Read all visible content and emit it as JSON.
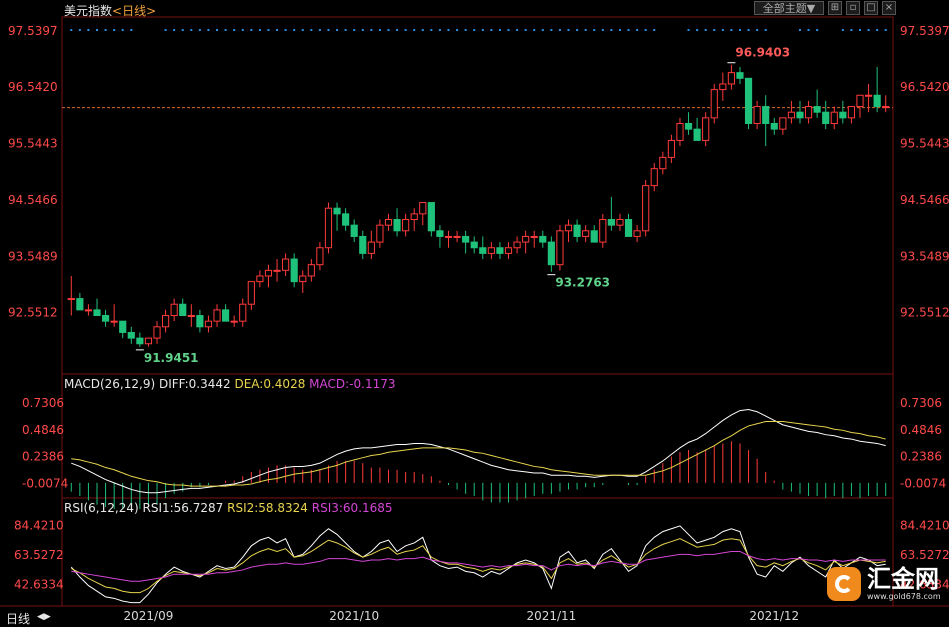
{
  "header": {
    "instrument": "美元指数",
    "timeframe": "<日线>",
    "theme_label": "全部主题▼",
    "icons": [
      "grid-icon",
      "restore-icon",
      "maximize-icon",
      "close-icon"
    ]
  },
  "chart_data": [
    {
      "type": "candlestick",
      "title": "美元指数 <日线>",
      "ylim": [
        91.5,
        97.75
      ],
      "y_ticks": [
        "97.5397",
        "96.5420",
        "95.5443",
        "94.5466",
        "93.5489",
        "92.5512"
      ],
      "x_ticks": [
        "2021/09",
        "2021/10",
        "2021/11",
        "2021/12"
      ],
      "annotations": {
        "high": "96.9403",
        "low1": "91.9451",
        "low2": "93.2763"
      },
      "last_price": 96.18,
      "candles": [
        [
          92.8,
          93.2,
          92.5,
          92.8
        ],
        [
          92.8,
          92.9,
          92.6,
          92.6
        ],
        [
          92.6,
          92.7,
          92.5,
          92.6
        ],
        [
          92.6,
          92.8,
          92.5,
          92.5
        ],
        [
          92.5,
          92.6,
          92.3,
          92.4
        ],
        [
          92.4,
          92.7,
          92.3,
          92.4
        ],
        [
          92.4,
          92.4,
          92.1,
          92.2
        ],
        [
          92.2,
          92.3,
          92.0,
          92.1
        ],
        [
          92.1,
          92.2,
          91.9451,
          92.0
        ],
        [
          92.0,
          92.1,
          91.95,
          92.1
        ],
        [
          92.1,
          92.4,
          92.0,
          92.3
        ],
        [
          92.3,
          92.6,
          92.2,
          92.5
        ],
        [
          92.5,
          92.8,
          92.4,
          92.7
        ],
        [
          92.7,
          92.8,
          92.5,
          92.5
        ],
        [
          92.5,
          92.7,
          92.3,
          92.5
        ],
        [
          92.5,
          92.6,
          92.2,
          92.3
        ],
        [
          92.3,
          92.5,
          92.2,
          92.4
        ],
        [
          92.4,
          92.7,
          92.3,
          92.6
        ],
        [
          92.6,
          92.7,
          92.4,
          92.4
        ],
        [
          92.4,
          92.5,
          92.3,
          92.4
        ],
        [
          92.4,
          92.8,
          92.3,
          92.7
        ],
        [
          92.7,
          93.1,
          92.6,
          93.1
        ],
        [
          93.1,
          93.3,
          93.0,
          93.2
        ],
        [
          93.2,
          93.4,
          93.0,
          93.3
        ],
        [
          93.3,
          93.5,
          93.1,
          93.3
        ],
        [
          93.3,
          93.6,
          93.2,
          93.5
        ],
        [
          93.5,
          93.6,
          93.0,
          93.1
        ],
        [
          93.1,
          93.3,
          92.9,
          93.2
        ],
        [
          93.2,
          93.5,
          93.1,
          93.4
        ],
        [
          93.4,
          93.8,
          93.3,
          93.7
        ],
        [
          93.7,
          94.5,
          93.6,
          94.4
        ],
        [
          94.4,
          94.5,
          94.0,
          94.3
        ],
        [
          94.3,
          94.4,
          94.0,
          94.1
        ],
        [
          94.1,
          94.2,
          93.8,
          93.9
        ],
        [
          93.9,
          94.0,
          93.5,
          93.6
        ],
        [
          93.6,
          94.0,
          93.5,
          93.8
        ],
        [
          93.8,
          94.2,
          93.7,
          94.1
        ],
        [
          94.1,
          94.3,
          94.0,
          94.2
        ],
        [
          94.2,
          94.4,
          93.9,
          94.0
        ],
        [
          94.0,
          94.3,
          93.9,
          94.2
        ],
        [
          94.2,
          94.4,
          94.0,
          94.3
        ],
        [
          94.3,
          94.5,
          94.1,
          94.5
        ],
        [
          94.5,
          94.5,
          93.9,
          94.0
        ],
        [
          94.0,
          94.1,
          93.7,
          93.9
        ],
        [
          93.9,
          94.0,
          93.7,
          93.9
        ],
        [
          93.9,
          94.0,
          93.8,
          93.9
        ],
        [
          93.9,
          94.0,
          93.6,
          93.8
        ],
        [
          93.8,
          93.9,
          93.6,
          93.7
        ],
        [
          93.7,
          93.9,
          93.5,
          93.6
        ],
        [
          93.6,
          93.8,
          93.5,
          93.7
        ],
        [
          93.7,
          93.8,
          93.5,
          93.6
        ],
        [
          93.6,
          93.8,
          93.5,
          93.7
        ],
        [
          93.7,
          93.9,
          93.6,
          93.8
        ],
        [
          93.8,
          94.0,
          93.6,
          93.9
        ],
        [
          93.9,
          94.0,
          93.7,
          93.9
        ],
        [
          93.9,
          94.0,
          93.7,
          93.8
        ],
        [
          93.8,
          93.9,
          93.2763,
          93.4
        ],
        [
          93.4,
          94.1,
          93.3,
          94.0
        ],
        [
          94.0,
          94.2,
          93.8,
          94.1
        ],
        [
          94.1,
          94.2,
          93.8,
          93.9
        ],
        [
          93.9,
          94.1,
          93.8,
          94.0
        ],
        [
          94.0,
          94.1,
          93.8,
          93.8
        ],
        [
          93.8,
          94.3,
          93.7,
          94.2
        ],
        [
          94.2,
          94.6,
          94.0,
          94.1
        ],
        [
          94.1,
          94.3,
          94.0,
          94.2
        ],
        [
          94.2,
          94.3,
          93.9,
          93.9
        ],
        [
          93.9,
          94.1,
          93.8,
          94.0
        ],
        [
          94.0,
          94.9,
          93.9,
          94.8
        ],
        [
          94.8,
          95.2,
          94.7,
          95.1
        ],
        [
          95.1,
          95.4,
          95.0,
          95.3
        ],
        [
          95.3,
          95.7,
          95.2,
          95.6
        ],
        [
          95.6,
          96.0,
          95.5,
          95.9
        ],
        [
          95.9,
          96.1,
          95.7,
          95.8
        ],
        [
          95.8,
          96.0,
          95.6,
          95.6
        ],
        [
          95.6,
          96.1,
          95.5,
          96.0
        ],
        [
          96.0,
          96.6,
          95.9,
          96.5
        ],
        [
          96.5,
          96.8,
          96.3,
          96.6
        ],
        [
          96.6,
          96.9403,
          96.5,
          96.8
        ],
        [
          96.8,
          96.9,
          96.6,
          96.7
        ],
        [
          96.7,
          96.7,
          95.8,
          95.9
        ],
        [
          95.9,
          96.3,
          95.8,
          96.2
        ],
        [
          96.2,
          96.4,
          95.5,
          95.9
        ],
        [
          95.9,
          96.0,
          95.7,
          95.8
        ],
        [
          95.8,
          96.0,
          95.7,
          96.0
        ],
        [
          96.0,
          96.3,
          95.9,
          96.1
        ],
        [
          96.1,
          96.3,
          95.9,
          96.0
        ],
        [
          96.0,
          96.3,
          95.9,
          96.2
        ],
        [
          96.2,
          96.5,
          96.0,
          96.1
        ],
        [
          96.1,
          96.3,
          95.8,
          95.9
        ],
        [
          95.9,
          96.2,
          95.8,
          96.1
        ],
        [
          96.1,
          96.3,
          95.9,
          96.0
        ],
        [
          96.0,
          96.2,
          95.9,
          96.2
        ],
        [
          96.2,
          96.4,
          96.0,
          96.4
        ],
        [
          96.4,
          96.6,
          96.1,
          96.4
        ],
        [
          96.4,
          96.9,
          96.1,
          96.2
        ],
        [
          96.2,
          96.4,
          96.1,
          96.2
        ]
      ]
    },
    {
      "type": "bar+line",
      "title": "MACD(26,12,9)",
      "legend": {
        "name": "MACD(26,12,9)",
        "diff": "DIFF:0.3442",
        "dea": "DEA:0.4028",
        "macd": "MACD:-0.1173"
      },
      "ylim": [
        -0.12,
        0.83
      ],
      "y_ticks": [
        "0.7306",
        "0.4846",
        "0.2386",
        "-0.0074"
      ],
      "series": [
        {
          "name": "DIFF",
          "color": "#ffffff",
          "values": [
            0.18,
            0.15,
            0.11,
            0.07,
            0.03,
            0.0,
            -0.03,
            -0.06,
            -0.08,
            -0.09,
            -0.09,
            -0.08,
            -0.07,
            -0.06,
            -0.05,
            -0.05,
            -0.04,
            -0.03,
            -0.02,
            -0.01,
            0.01,
            0.04,
            0.07,
            0.1,
            0.12,
            0.14,
            0.15,
            0.15,
            0.16,
            0.18,
            0.22,
            0.26,
            0.29,
            0.31,
            0.32,
            0.32,
            0.33,
            0.34,
            0.35,
            0.35,
            0.36,
            0.36,
            0.35,
            0.33,
            0.31,
            0.28,
            0.25,
            0.22,
            0.19,
            0.16,
            0.14,
            0.12,
            0.11,
            0.1,
            0.09,
            0.09,
            0.07,
            0.07,
            0.07,
            0.06,
            0.06,
            0.05,
            0.06,
            0.07,
            0.07,
            0.06,
            0.06,
            0.1,
            0.15,
            0.2,
            0.26,
            0.32,
            0.37,
            0.4,
            0.45,
            0.51,
            0.57,
            0.62,
            0.66,
            0.67,
            0.65,
            0.61,
            0.57,
            0.53,
            0.51,
            0.49,
            0.47,
            0.46,
            0.44,
            0.43,
            0.41,
            0.4,
            0.38,
            0.37,
            0.36,
            0.34
          ]
        },
        {
          "name": "DEA",
          "color": "#e8d44d",
          "values": [
            0.22,
            0.21,
            0.19,
            0.17,
            0.14,
            0.12,
            0.09,
            0.06,
            0.04,
            0.02,
            0.01,
            -0.01,
            -0.02,
            -0.02,
            -0.03,
            -0.03,
            -0.03,
            -0.03,
            -0.03,
            -0.02,
            -0.02,
            -0.01,
            0.01,
            0.03,
            0.04,
            0.06,
            0.08,
            0.09,
            0.1,
            0.12,
            0.14,
            0.16,
            0.19,
            0.21,
            0.23,
            0.25,
            0.26,
            0.28,
            0.29,
            0.3,
            0.31,
            0.32,
            0.32,
            0.32,
            0.32,
            0.31,
            0.3,
            0.28,
            0.27,
            0.25,
            0.23,
            0.21,
            0.19,
            0.17,
            0.15,
            0.14,
            0.12,
            0.11,
            0.1,
            0.09,
            0.08,
            0.07,
            0.07,
            0.07,
            0.07,
            0.07,
            0.07,
            0.07,
            0.09,
            0.11,
            0.14,
            0.18,
            0.22,
            0.26,
            0.3,
            0.34,
            0.39,
            0.43,
            0.48,
            0.52,
            0.54,
            0.56,
            0.56,
            0.56,
            0.55,
            0.54,
            0.53,
            0.52,
            0.51,
            0.49,
            0.48,
            0.46,
            0.45,
            0.43,
            0.42,
            0.4
          ]
        }
      ],
      "histogram_scale": 1
    },
    {
      "type": "line",
      "title": "RSI(6,12,24)",
      "legend": {
        "name": "RSI(6,12,24)",
        "rsi1": "RSI1:56.7287",
        "rsi2": "RSI2:58.8324",
        "rsi3": "RSI3:60.1685"
      },
      "ylim": [
        29,
        91
      ],
      "y_ticks": [
        "84.4210",
        "63.5272",
        "42.6334"
      ],
      "series": [
        {
          "name": "RSI1",
          "color": "#ffffff",
          "values": [
            55,
            48,
            42,
            38,
            34,
            33,
            31,
            30,
            30,
            36,
            44,
            50,
            55,
            52,
            50,
            48,
            52,
            56,
            54,
            55,
            62,
            70,
            74,
            76,
            72,
            75,
            62,
            64,
            70,
            77,
            82,
            78,
            72,
            66,
            62,
            66,
            72,
            74,
            66,
            70,
            72,
            76,
            60,
            56,
            54,
            55,
            52,
            51,
            48,
            52,
            50,
            54,
            58,
            60,
            58,
            54,
            40,
            62,
            66,
            58,
            60,
            54,
            64,
            68,
            60,
            52,
            56,
            70,
            76,
            80,
            82,
            84,
            78,
            72,
            74,
            76,
            80,
            82,
            80,
            62,
            50,
            48,
            56,
            52,
            58,
            62,
            56,
            52,
            48,
            60,
            54,
            58,
            62,
            60,
            56,
            57
          ]
        },
        {
          "name": "RSI2",
          "color": "#e8d44d",
          "values": [
            54,
            51,
            47,
            44,
            41,
            40,
            38,
            37,
            37,
            40,
            45,
            49,
            52,
            51,
            50,
            49,
            51,
            54,
            53,
            54,
            58,
            63,
            66,
            68,
            66,
            68,
            62,
            63,
            66,
            70,
            74,
            72,
            69,
            65,
            62,
            64,
            67,
            69,
            64,
            66,
            67,
            70,
            62,
            59,
            57,
            57,
            55,
            54,
            52,
            54,
            53,
            55,
            57,
            58,
            57,
            55,
            47,
            58,
            61,
            57,
            58,
            55,
            60,
            63,
            59,
            55,
            57,
            64,
            68,
            71,
            73,
            75,
            72,
            69,
            70,
            71,
            74,
            75,
            74,
            63,
            56,
            55,
            58,
            56,
            59,
            61,
            58,
            56,
            53,
            59,
            56,
            58,
            60,
            59,
            58,
            59
          ]
        },
        {
          "name": "RSI3",
          "color": "#d546d6",
          "values": [
            52,
            51,
            50,
            49,
            48,
            47,
            46,
            45,
            45,
            46,
            47,
            48,
            50,
            50,
            50,
            50,
            50,
            51,
            51,
            52,
            53,
            55,
            56,
            57,
            57,
            58,
            57,
            57,
            58,
            59,
            61,
            61,
            61,
            60,
            59,
            60,
            60,
            61,
            60,
            61,
            61,
            62,
            60,
            59,
            58,
            58,
            57,
            56,
            55,
            56,
            55,
            56,
            56,
            57,
            56,
            56,
            53,
            56,
            57,
            56,
            57,
            56,
            58,
            59,
            58,
            57,
            57,
            60,
            61,
            62,
            63,
            64,
            64,
            63,
            64,
            64,
            65,
            66,
            66,
            63,
            61,
            60,
            61,
            60,
            61,
            61,
            60,
            60,
            59,
            60,
            59,
            60,
            60,
            60,
            60,
            60
          ]
        }
      ]
    }
  ],
  "footer": {
    "period": "日线",
    "arrow": "◀▶"
  },
  "watermark": {
    "name": "汇金网",
    "url": "www.gold678.com"
  }
}
